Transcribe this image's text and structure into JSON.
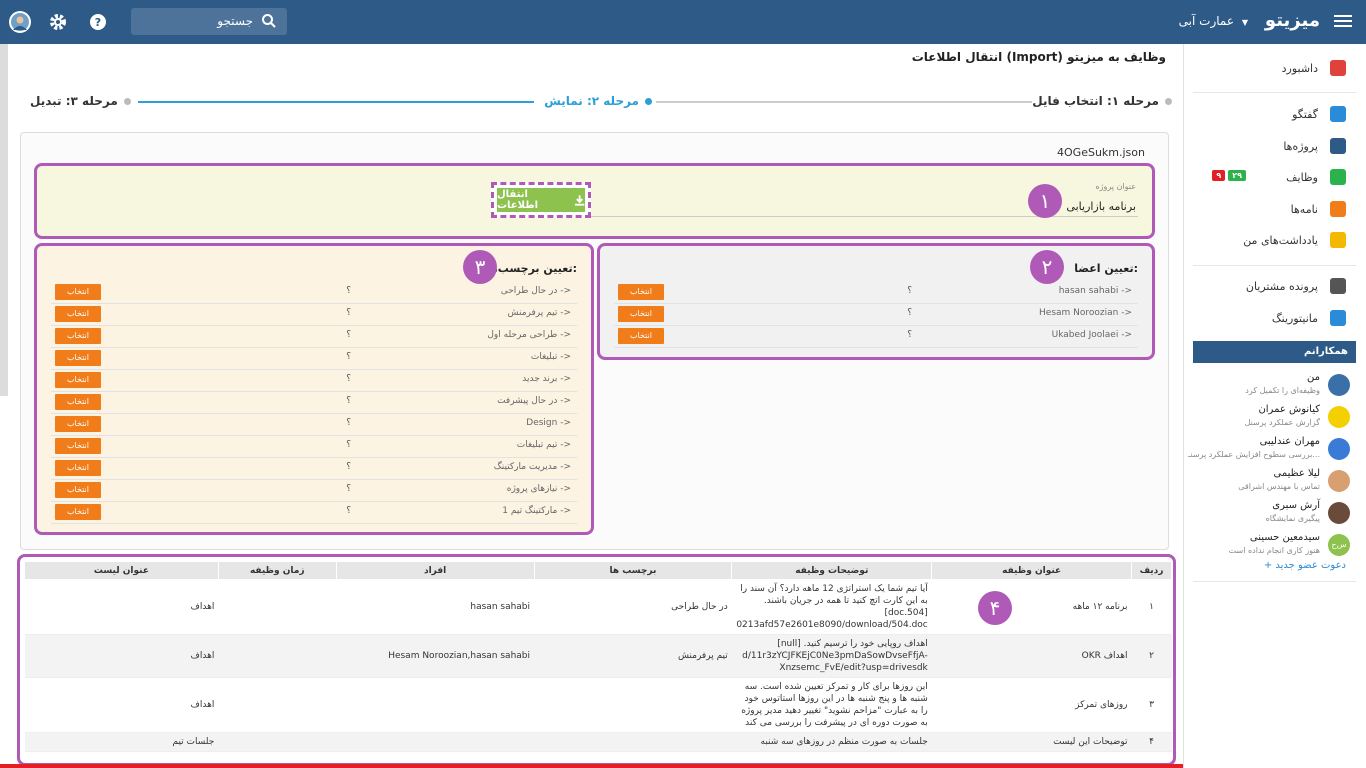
{
  "header": {
    "brand": "میزیتو",
    "company": "عمارت آبی",
    "search_label": "جستجو"
  },
  "page": {
    "title": "انتقال اطلاعات (Import) وظایف به میزیتو",
    "steps": [
      {
        "label": "مرحله ۱: انتخاب فایل",
        "state": "done"
      },
      {
        "label": "مرحله ۲: نمایش",
        "state": "active"
      },
      {
        "label": "مرحله ۳: تبدیل",
        "state": "pending"
      }
    ],
    "filename": "4OGeSukm.json"
  },
  "project": {
    "label": "عنوان پروژه",
    "value": "برنامه بازاریابی",
    "import_button": "انتقال اطلاعات"
  },
  "markers": [
    "۱",
    "۲",
    "۳",
    "۴"
  ],
  "members": {
    "title": "تعیین اعضا:",
    "rows": [
      {
        "source": "hasan sahabi ->",
        "target": "؟",
        "button": "انتخاب"
      },
      {
        "source": "Hesam Noroozian ->",
        "target": "؟",
        "button": "انتخاب"
      },
      {
        "source": "Ukabed Joolaei ->",
        "target": "؟",
        "button": "انتخاب"
      }
    ]
  },
  "tags": {
    "title": "تعیین برچسب‌ها:",
    "rows": [
      {
        "source": "در حال طراحی ->",
        "target": "؟",
        "button": "انتخاب"
      },
      {
        "source": "تیم پرفرمنش ->",
        "target": "؟",
        "button": "انتخاب"
      },
      {
        "source": "طراحی مرحله اول ->",
        "target": "؟",
        "button": "انتخاب"
      },
      {
        "source": "تبلیغات ->",
        "target": "؟",
        "button": "انتخاب"
      },
      {
        "source": "برند جدید ->",
        "target": "؟",
        "button": "انتخاب"
      },
      {
        "source": "در حال پیشرفت ->",
        "target": "؟",
        "button": "انتخاب"
      },
      {
        "source": "Design ->",
        "target": "؟",
        "button": "انتخاب"
      },
      {
        "source": "تیم تبلیغات ->",
        "target": "؟",
        "button": "انتخاب"
      },
      {
        "source": "مدیریت مارکتینگ ->",
        "target": "؟",
        "button": "انتخاب"
      },
      {
        "source": "نیازهای پروژه ->",
        "target": "؟",
        "button": "انتخاب"
      },
      {
        "source": "مارکتینگ تیم 1 ->",
        "target": "؟",
        "button": "انتخاب"
      }
    ]
  },
  "table": {
    "headers": [
      "ردیف",
      "عنوان وظیفه",
      "توضیحات وظیفه",
      "برچسب ها",
      "افراد",
      "زمان وظیفه",
      "عنوان لیست"
    ],
    "rows": [
      {
        "n": "۱",
        "title": "برنامه ۱۲ ماهه",
        "desc": "آیا تیم شما یک استراتژی 12 ماهه دارد؟ آن سند را به این کارت اتچ کنید تا همه در جریان باشند. [doc.504] 0213afd57e2601e8090/download/504.doc",
        "tags": "در حال طراحی",
        "people": "hasan sahabi",
        "time": "",
        "list": "اهداف"
      },
      {
        "n": "۲",
        "title": "اهداف OKR",
        "desc": "اهداف روپایی خود را ترسیم کنید. [null] d/11r3zYCJFKEjC0Ne3pmDaSowDvseFfjA-Xnzsemc_FvE/edit?usp=drivesdk",
        "tags": "تیم پرفرمنش",
        "people": "Hesam Noroozian,hasan sahabi",
        "time": "",
        "list": "اهداف"
      },
      {
        "n": "۳",
        "title": "روزهای تمرکز",
        "desc": "این روزها برای کار و تمرکز تعیین شده است. سه شنبه ها و پنج شنبه ها در این روزها استاتوس خود را به عبارت \"مزاحم نشوید\" تغییر دهید مدیر پروژه به صورت دوره ای در پیشرفت را بررسی می کند",
        "tags": "",
        "people": "",
        "time": "",
        "list": "اهداف"
      },
      {
        "n": "۴",
        "title": "توضیحات این لیست",
        "desc": "جلسات به صورت منظم در روزهای سه شنبه",
        "tags": "",
        "people": "",
        "time": "",
        "list": "جلسات تیم"
      }
    ]
  },
  "sidebar": {
    "items": [
      {
        "label": "داشبورد",
        "icon": "home-icon",
        "color": "#e0413b"
      },
      {
        "label": "گفتگو",
        "icon": "chat-icon",
        "color": "#2a8cd8"
      },
      {
        "label": "پروژه‌ها",
        "icon": "projects-icon",
        "color": "#2e5a87"
      },
      {
        "label": "وظایف",
        "icon": "tasks-icon",
        "color": "#2bb24c",
        "badge_green": "۲۹",
        "badge_red": "۹"
      },
      {
        "label": "نامه‌ها",
        "icon": "mail-icon",
        "color": "#f07c1a"
      },
      {
        "label": "یادداشت‌های من",
        "icon": "notes-icon",
        "color": "#f5b800"
      },
      {
        "label": "پرونده مشتریان",
        "icon": "customers-icon",
        "color": "#555555"
      },
      {
        "label": "مانیتورینگ",
        "icon": "monitoring-icon",
        "color": "#2a8cd8"
      }
    ],
    "team_title": "همکارانم",
    "teammates": [
      {
        "name": "من",
        "status": "وظیفه‌ای را تکمیل کرد",
        "color": "#3b6fa8"
      },
      {
        "name": "کیانوش عمران",
        "status": "گزارش عملکرد پرسنل",
        "color": "#f5d000"
      },
      {
        "name": "مهران عندلیبی",
        "status": "بررسی سطوح افزایش عملکرد پرسنـ...",
        "color": "#3b7bd8"
      },
      {
        "name": "لیلا عظیمی",
        "status": "تماس با مهندس اشراقی",
        "color": "#d8a070"
      },
      {
        "name": "آرش سبری",
        "status": "پیگیری نمایشگاه",
        "color": "#6a4a3a"
      },
      {
        "name": "سیدمعین حسینی",
        "status": "هنوز کاری انجام نداده است",
        "color": "#8cc24d",
        "initials": "س‌ح"
      }
    ],
    "invite": "+ دعوت عضو جدید"
  },
  "colors": {
    "primary": "#2e5a87",
    "accent_purple": "#b05ab8",
    "orange": "#f07c1a",
    "green": "#8cc24d",
    "step_active": "#2a9fd8"
  }
}
